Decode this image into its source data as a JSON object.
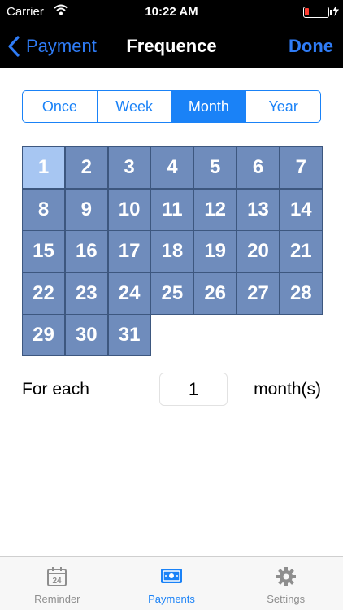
{
  "status_bar": {
    "carrier": "Carrier",
    "time": "10:22 AM"
  },
  "nav": {
    "back_label": "Payment",
    "title": "Frequence",
    "done_label": "Done"
  },
  "segments": [
    {
      "label": "Once",
      "selected": false
    },
    {
      "label": "Week",
      "selected": false
    },
    {
      "label": "Month",
      "selected": true
    },
    {
      "label": "Year",
      "selected": false
    }
  ],
  "days": [
    "1",
    "2",
    "3",
    "4",
    "5",
    "6",
    "7",
    "8",
    "9",
    "10",
    "11",
    "12",
    "13",
    "14",
    "15",
    "16",
    "17",
    "18",
    "19",
    "20",
    "21",
    "22",
    "23",
    "24",
    "25",
    "26",
    "27",
    "28",
    "29",
    "30",
    "31"
  ],
  "selected_day": "1",
  "interval": {
    "label": "For each",
    "value": "1",
    "unit": "month(s)"
  },
  "tabs": [
    {
      "label": "Reminder",
      "icon": "calendar-icon",
      "calendar_day": "24",
      "active": false
    },
    {
      "label": "Payments",
      "icon": "payment-card-icon",
      "active": true
    },
    {
      "label": "Settings",
      "icon": "gear-icon",
      "active": false
    }
  ],
  "colors": {
    "accent": "#1a82f7",
    "day_cell": "#6f8cbc",
    "day_selected": "#a7c6f2",
    "battery_low": "#ff3b30"
  }
}
